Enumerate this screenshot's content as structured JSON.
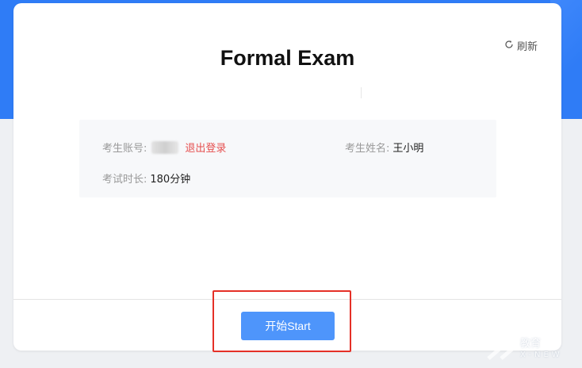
{
  "page": {
    "title": "Formal Exam",
    "refresh_label": "刷新"
  },
  "candidate": {
    "account_label": "考生账号:",
    "logout_label": "退出登录",
    "name_label": "考生姓名:",
    "name_value": "王小明",
    "duration_label": "考试时长:",
    "duration_value": "180分钟"
  },
  "footer": {
    "start_label": "开始Start"
  },
  "watermark": {
    "brand": "教育",
    "sub": "X-NEW"
  },
  "colors": {
    "header_blue": "#2f7cf6",
    "start_button": "#4e95fb",
    "logout_red": "#e65050",
    "highlight_red": "#e53027"
  },
  "icons": {
    "refresh": "refresh-icon"
  }
}
